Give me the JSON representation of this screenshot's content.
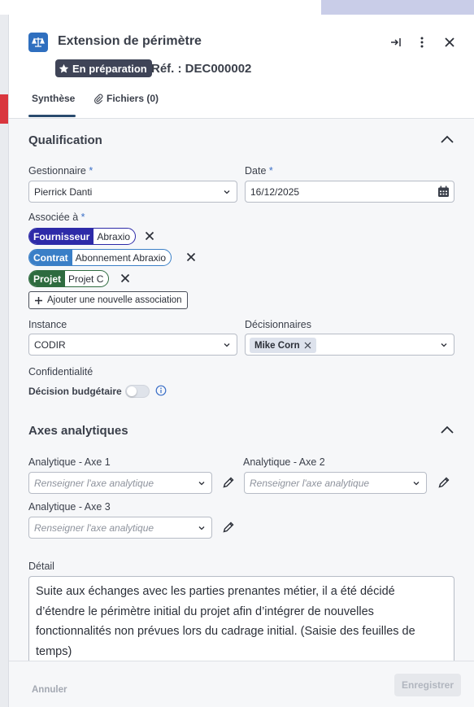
{
  "header": {
    "title": "Extension de périmètre",
    "status_badge": "En préparation",
    "reference": "Réf. : DEC000002",
    "tabs": [
      {
        "label": "Synthèse"
      },
      {
        "label": "Fichiers (0)"
      }
    ]
  },
  "qualification": {
    "title": "Qualification",
    "manager_label": "Gestionnaire",
    "manager_value": "Pierrick Danti",
    "date_label": "Date",
    "date_value": "16/12/2025",
    "associated_label": "Associée à",
    "associations": [
      {
        "type": "Fournisseur",
        "value": "Abraxio",
        "color": "#2d2aa8"
      },
      {
        "type": "Contrat",
        "value": "Abonnement Abraxio",
        "color": "#3a7fc7"
      },
      {
        "type": "Projet",
        "value": "Projet C",
        "color": "#2e6b3f"
      }
    ],
    "add_association_label": "Ajouter une nouvelle association",
    "instance_label": "Instance",
    "instance_value": "CODIR",
    "decision_makers_label": "Décisionnaires",
    "decision_makers": [
      "Mike Corn"
    ],
    "confidentiality_label": "Confidentialité",
    "budget_decision_label": "Décision budgétaire",
    "budget_decision_on": false
  },
  "analytics": {
    "title": "Axes analytiques",
    "axis1_label": "Analytique - Axe 1",
    "axis2_label": "Analytique - Axe 2",
    "axis3_label": "Analytique - Axe 3",
    "placeholder": "Renseigner l'axe analytique"
  },
  "detail": {
    "label": "Détail",
    "text": "Suite aux échanges avec les parties prenantes métier, il a été décidé d’étendre le périmètre initial du projet afin d’intégrer de nouvelles fonctionnalités non prévues lors du cadrage initial. (Saisie des feuilles de temps)"
  },
  "footer": {
    "cancel_label": "Annuler",
    "save_label": "Enregistrer"
  },
  "colors": {
    "accent": "#2f6fbf",
    "status_badge_bg": "#3f4457"
  }
}
